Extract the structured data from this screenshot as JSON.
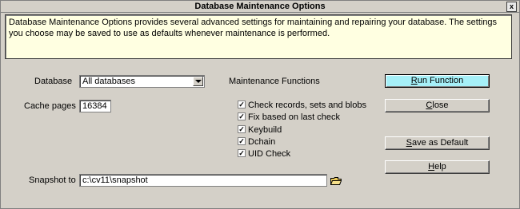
{
  "window": {
    "title": "Database Maintenance Options",
    "close_glyph": "x"
  },
  "description": "Database Maintenance Options provides several advanced settings for maintaining and repairing your database. The settings you choose may be saved to use as defaults whenever maintenance is performed.",
  "database": {
    "label": "Database",
    "value": "All databases"
  },
  "cache": {
    "label": "Cache pages",
    "value": "16384"
  },
  "snapshot": {
    "label": "Snapshot to",
    "value": "c:\\cv11\\snapshot"
  },
  "maintenance": {
    "heading": "Maintenance Functions",
    "options": [
      {
        "label": "Check records, sets and blobs",
        "checked": true
      },
      {
        "label": "Fix based on last check",
        "checked": true
      },
      {
        "label": "Keybuild",
        "checked": true
      },
      {
        "label": "Dchain",
        "checked": true
      },
      {
        "label": "UID Check",
        "checked": true
      }
    ]
  },
  "buttons": {
    "run": {
      "prefix": "",
      "mnemonic": "R",
      "rest": "un Function"
    },
    "close": {
      "prefix": "",
      "mnemonic": "C",
      "rest": "lose"
    },
    "save_default": {
      "prefix": "",
      "mnemonic": "S",
      "rest": "ave as Default"
    },
    "help": {
      "prefix": "",
      "mnemonic": "H",
      "rest": "elp"
    }
  },
  "check_glyph": "✓",
  "icons": {
    "combo": "chevron-down-icon",
    "folder": "folder-open-icon"
  }
}
